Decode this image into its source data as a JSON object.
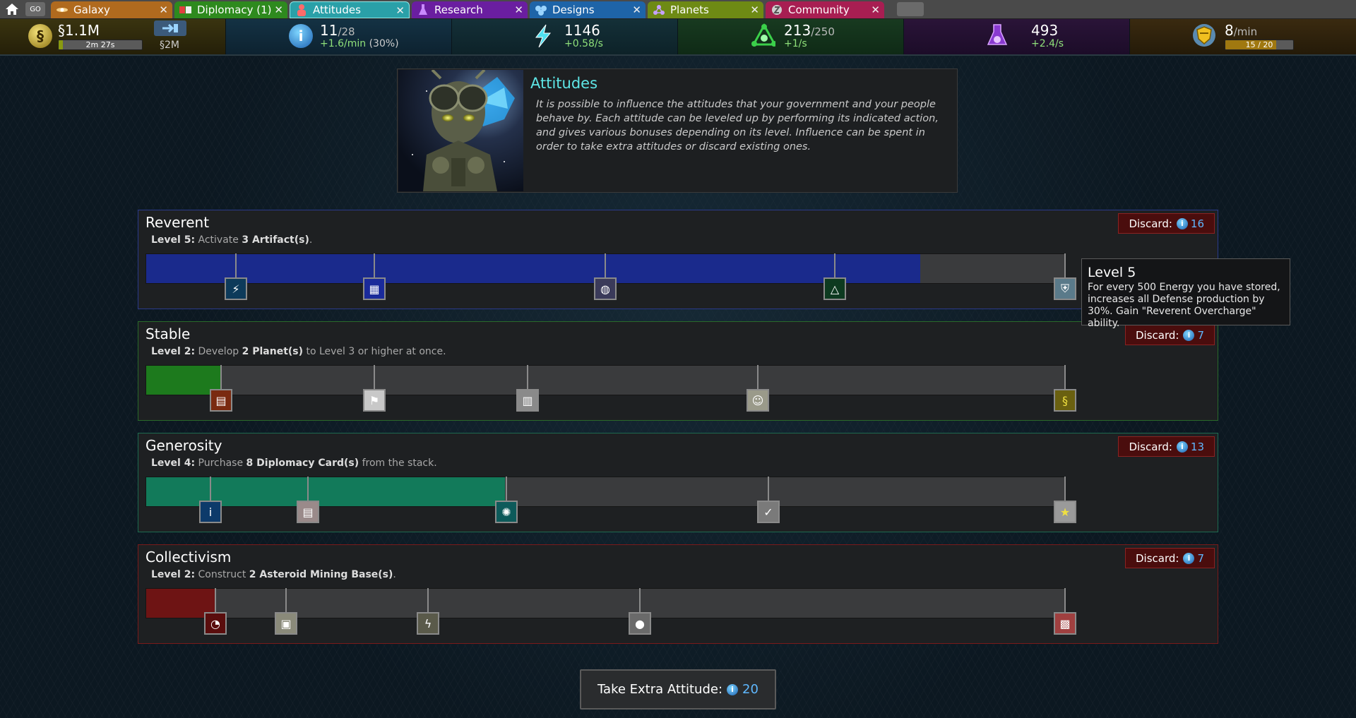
{
  "colors": {
    "accent_cyan": "#5ee6e6",
    "influence_blue": "#5fb8ff",
    "rate_green": "#8fe07a",
    "reverent": "#1a2a8c",
    "stable": "#1d7a1d",
    "generosity": "#127a5a",
    "collectivism": "#6e1414"
  },
  "tabbar": {
    "home_icon": "home-icon",
    "go_label": "GO",
    "tabs": [
      {
        "label": "Galaxy",
        "icon": "galaxy-icon",
        "color": "#b06a1e"
      },
      {
        "label": "Diplomacy (1)",
        "icon": "diplomacy-icon",
        "color": "#2e8a1e"
      },
      {
        "label": "Attitudes",
        "icon": "attitudes-icon",
        "color": "#2aa0a8"
      },
      {
        "label": "Research",
        "icon": "research-icon",
        "color": "#6a1ea0"
      },
      {
        "label": "Designs",
        "icon": "designs-icon",
        "color": "#1e64a8"
      },
      {
        "label": "Planets",
        "icon": "planets-icon",
        "color": "#6e8a14"
      },
      {
        "label": "Community",
        "icon": "community-icon",
        "color": "#a81e52"
      }
    ],
    "close_symbol": "✕"
  },
  "resources": {
    "credits": {
      "value": "§1.1M",
      "timer": "2m 27s",
      "timer_progress": 0.05,
      "icon": "credits-icon"
    },
    "transfer": {
      "value": "§2M",
      "icon": "transfer-icon"
    },
    "influence": {
      "value": "11",
      "max": "/28",
      "rate": "+1.6/min",
      "pct": "(30%)",
      "icon": "influence-icon"
    },
    "energy": {
      "value": "1146",
      "rate": "+0.58/s",
      "icon": "energy-icon"
    },
    "minerals": {
      "value": "213",
      "max": "/250",
      "rate": "+1/s",
      "icon": "minerals-icon"
    },
    "research": {
      "value": "493",
      "rate": "+2.4/s",
      "icon": "research-flask-icon"
    },
    "defense": {
      "value": "8",
      "unit": "/min",
      "progress_text": "15 / 20",
      "progress": 0.75,
      "icon": "defense-icon"
    }
  },
  "info": {
    "title": "Attitudes",
    "description": "It is possible to influence the attitudes that your government and your people behave by. Each attitude can be leveled up by performing its indicated action, and gives various bonuses depending on its level. Influence can be spent in order to take extra attitudes or discard existing ones."
  },
  "attitudes": [
    {
      "name": "Reverent",
      "level_label": "Level 5:",
      "action_pre": "Activate",
      "action_bold": "3 Artifact(s)",
      "action_post": ".",
      "discard_label": "Discard:",
      "discard_cost": "16",
      "progress": 0.843,
      "nodes": [
        "energy-bolt-icon",
        "blue-grid-icon",
        "planet-orb-icon",
        "minerals-icon",
        "defense-shield-icon"
      ]
    },
    {
      "name": "Stable",
      "level_label": "Level 2:",
      "action_pre": "Develop",
      "action_bold": "2 Planet(s)",
      "action_post": " to Level 3 or higher at once.",
      "discard_label": "Discard:",
      "discard_cost": "7",
      "progress": 0.081,
      "nodes": [
        "clipboard-icon",
        "flag-icon",
        "grid-panel-icon",
        "smiley-icon",
        "credits-icon"
      ]
    },
    {
      "name": "Generosity",
      "level_label": "Level 4:",
      "action_pre": "Purchase",
      "action_bold": "8 Diplomacy Card(s)",
      "action_post": " from the stack.",
      "discard_label": "Discard:",
      "discard_cost": "13",
      "progress": 0.391,
      "nodes": [
        "influence-icon",
        "cards-icon",
        "swirl-icon",
        "checkmark-icon",
        "stars-icon"
      ]
    },
    {
      "name": "Collectivism",
      "level_label": "Level 2:",
      "action_pre": "Construct",
      "action_bold": "2 Asteroid Mining Base(s)",
      "action_post": ".",
      "discard_label": "Discard:",
      "discard_cost": "7",
      "progress": 0.075,
      "nodes": [
        "gauge-icon",
        "robot-icon",
        "lightning-box-icon",
        "asteroid-icon",
        "red-machine-icon"
      ]
    }
  ],
  "tooltip": {
    "title": "Level 5",
    "description": "For every 500 Energy you have stored, increases all Defense production by 30%. Gain \"Reverent Overcharge\" ability."
  },
  "extra_attitude": {
    "label": "Take Extra Attitude:",
    "cost": "20"
  }
}
